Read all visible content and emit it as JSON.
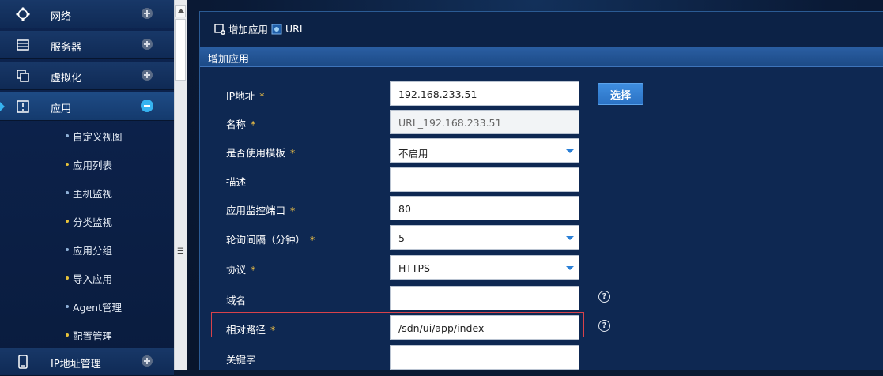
{
  "sidebar": {
    "items": [
      {
        "label": "网络",
        "icon": "network-icon"
      },
      {
        "label": "服务器",
        "icon": "server-icon"
      },
      {
        "label": "虚拟化",
        "icon": "virtualization-icon"
      },
      {
        "label": "应用",
        "icon": "application-icon",
        "active": true
      },
      {
        "label": "IP地址管理",
        "icon": "phone-icon"
      }
    ],
    "sub_items": [
      {
        "label": "自定义视图"
      },
      {
        "label": "应用列表"
      },
      {
        "label": "主机监视"
      },
      {
        "label": "分类监视"
      },
      {
        "label": "应用分组"
      },
      {
        "label": "导入应用"
      },
      {
        "label": "Agent管理"
      },
      {
        "label": "配置管理"
      }
    ]
  },
  "breadcrumb": {
    "first": "增加应用",
    "second": "URL"
  },
  "panel": {
    "title": "增加应用"
  },
  "form": {
    "ip_label": "IP地址",
    "ip_value": "192.168.233.51",
    "select_button": "选择",
    "name_label": "名称",
    "name_value": "URL_192.168.233.51",
    "template_label": "是否使用模板",
    "template_value": "不启用",
    "desc_label": "描述",
    "desc_value": "",
    "port_label": "应用监控端口",
    "port_value": "80",
    "interval_label": "轮询间隔（分钟）",
    "interval_value": "5",
    "protocol_label": "协议",
    "protocol_value": "HTTPS",
    "domain_label": "域名",
    "domain_value": "",
    "path_label": "相对路径",
    "path_value": "/sdn/ui/app/index",
    "keyword_label": "关键字",
    "keyword_value": "",
    "required_mark": "*",
    "help_glyph": "?"
  },
  "colors": {
    "accent": "#36b3f0",
    "required": "#f3c445",
    "highlight": "#d8424a"
  }
}
